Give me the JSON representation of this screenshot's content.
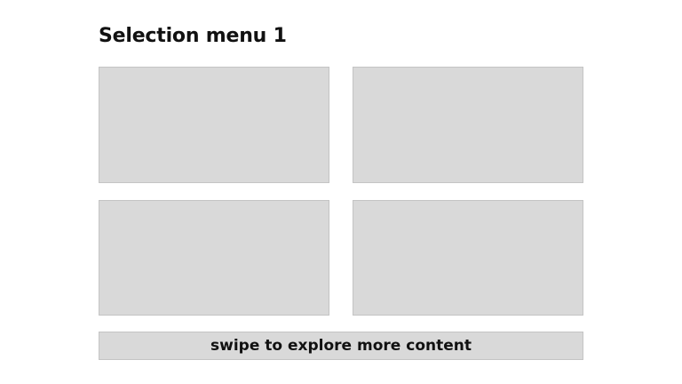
{
  "menu": {
    "title": "Selection menu 1",
    "tiles": [
      {
        "label": ""
      },
      {
        "label": ""
      },
      {
        "label": ""
      },
      {
        "label": ""
      }
    ],
    "swipe_hint": "swipe to explore more content"
  },
  "colors": {
    "background": "#ffffff",
    "tile_fill": "#d9d9d9",
    "tile_border": "#c4c4c4",
    "text": "#111111"
  }
}
